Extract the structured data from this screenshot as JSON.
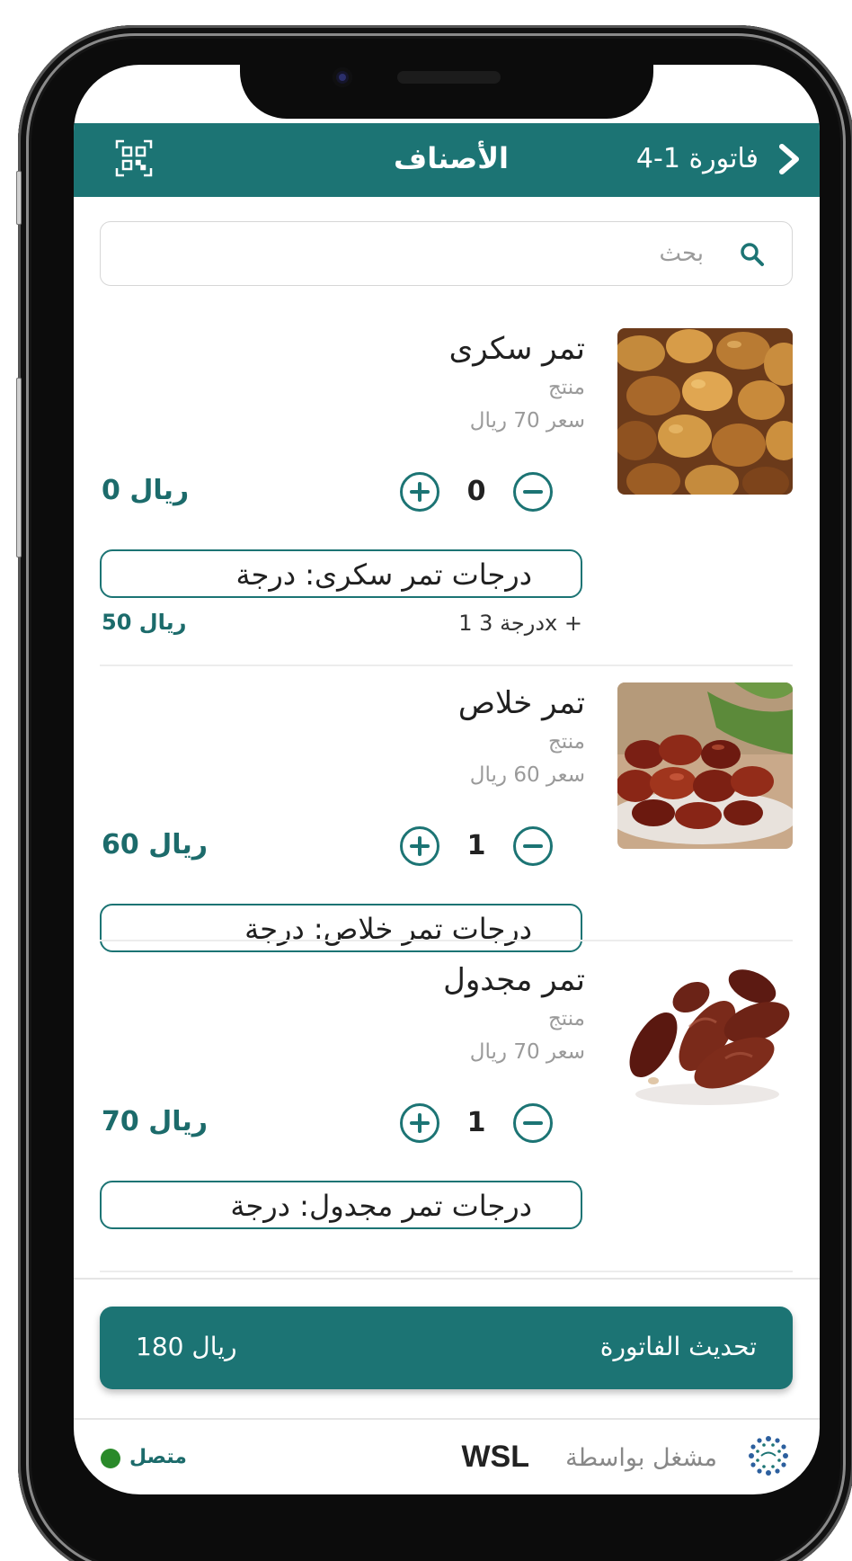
{
  "header": {
    "back_icon": "chevron-right-icon",
    "invoice_title": "فاتورة 1-4",
    "page_title": "الأصناف",
    "qr_icon": "qr-scan-icon"
  },
  "search": {
    "placeholder": "بحث",
    "icon": "search-icon"
  },
  "products": [
    {
      "name": "تمر سكرى",
      "type": "منتج",
      "price": "سعر 70 ريال",
      "quantity": "0",
      "total": "0 ريال",
      "grades_label": "درجات تمر سكرى: درجة",
      "grade_detail": "درجة 3 1x +",
      "grade_total": "50 ريال",
      "image": "sukkari-dates-photo"
    },
    {
      "name": "تمر خلاص",
      "type": "منتج",
      "price": "سعر 60 ريال",
      "quantity": "1",
      "total": "60 ريال",
      "grades_label": "درجات تمر خلاص: درجة",
      "image": "khalas-dates-photo"
    },
    {
      "name": "تمر مجدول",
      "type": "منتج",
      "price": "سعر 70 ريال",
      "quantity": "1",
      "total": "70 ريال",
      "grades_label": "درجات تمر مجدول: درجة",
      "image": "medjool-dates-photo"
    }
  ],
  "update_bar": {
    "label": "تحديث الفاتورة",
    "total": "180 ريال"
  },
  "footer": {
    "powered_by": "مشغل بواسطة",
    "brand": "WSL",
    "status": "متصل",
    "status_color": "#2a8a2a"
  },
  "colors": {
    "accent": "#1c7474"
  }
}
